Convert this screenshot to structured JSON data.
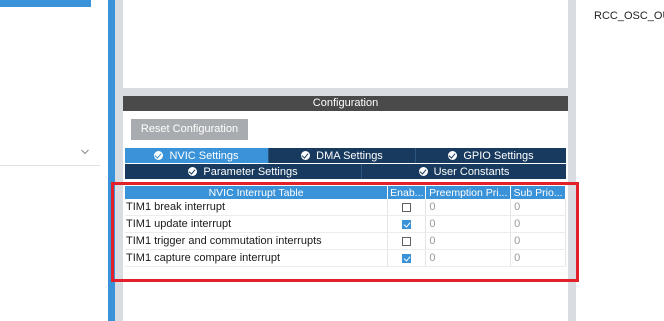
{
  "right_panel": {
    "pin_label": "RCC_OSC_OUT"
  },
  "configuration": {
    "header": "Configuration",
    "reset_button": "Reset Configuration",
    "tabs_row1": [
      {
        "label": "NVIC Settings",
        "active": true
      },
      {
        "label": "DMA Settings",
        "active": false
      },
      {
        "label": "GPIO Settings",
        "active": false
      }
    ],
    "tabs_row2": [
      {
        "label": "Parameter Settings",
        "active": false
      },
      {
        "label": "User Constants",
        "active": false
      }
    ]
  },
  "nvic_table": {
    "columns": [
      "NVIC Interrupt Table",
      "Enab...",
      "Preemption Pri...",
      "Sub Prio..."
    ],
    "rows": [
      {
        "name": "TIM1 break interrupt",
        "enabled": false,
        "preemption": "0",
        "sub": "0"
      },
      {
        "name": "TIM1 update interrupt",
        "enabled": true,
        "preemption": "0",
        "sub": "0"
      },
      {
        "name": "TIM1 trigger and commutation interrupts",
        "enabled": false,
        "preemption": "0",
        "sub": "0"
      },
      {
        "name": "TIM1 capture compare interrupt",
        "enabled": true,
        "preemption": "0",
        "sub": "0"
      }
    ]
  },
  "icons": {
    "left_dropdown": "chevron-down-icon",
    "tab_check": "check-circle-icon"
  },
  "colors": {
    "accent_blue": "#3a92d8",
    "dark_navy": "#173a5e",
    "header_gray": "#4a4a4a",
    "highlight_red": "#e2202a"
  }
}
